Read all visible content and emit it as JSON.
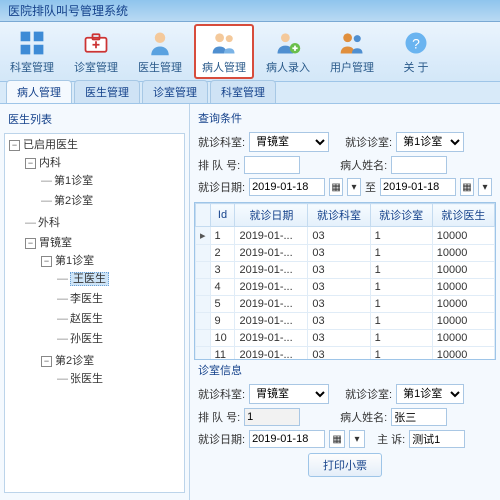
{
  "title": "医院排队叫号管理系统",
  "toolbar": [
    {
      "label": "科室管理"
    },
    {
      "label": "诊室管理"
    },
    {
      "label": "医生管理"
    },
    {
      "label": "病人管理",
      "selected": true
    },
    {
      "label": "病人录入"
    },
    {
      "label": "用户管理"
    },
    {
      "label": "关 于"
    }
  ],
  "tabs": [
    {
      "label": "病人管理",
      "active": true
    },
    {
      "label": "医生管理"
    },
    {
      "label": "诊室管理"
    },
    {
      "label": "科室管理"
    }
  ],
  "sidebar": {
    "title": "医生列表"
  },
  "tree": {
    "root": "已启用医生",
    "n_internal": "内科",
    "n_int_r1": "第1诊室",
    "n_int_r2": "第2诊室",
    "n_surgery": "外科",
    "n_gastro": "胃镜室",
    "n_g_r1": "第1诊室",
    "d_wang": "王医生",
    "d_li": "李医生",
    "d_zhao": "赵医生",
    "d_sun": "孙医生",
    "n_g_r2": "第2诊室",
    "d_zhang": "张医生"
  },
  "query": {
    "title": "查询条件",
    "dept_label": "就诊科室:",
    "dept_value": "胃镜室",
    "room_label": "就诊诊室:",
    "room_value": "第1诊室",
    "queue_label": "排 队 号:",
    "queue_value": "",
    "name_label": "病人姓名:",
    "name_value": "",
    "date_label": "就诊日期:",
    "date_from": "2019-01-18",
    "to_label": "至",
    "date_to": "2019-01-18"
  },
  "grid": {
    "headers": [
      "Id",
      "就诊日期",
      "就诊科室",
      "就诊诊室",
      "就诊医生"
    ],
    "rows": [
      {
        "mark": "▸",
        "cells": [
          "1",
          "2019-01-...",
          "03",
          "1",
          "10000"
        ]
      },
      {
        "mark": "",
        "cells": [
          "2",
          "2019-01-...",
          "03",
          "1",
          "10000"
        ]
      },
      {
        "mark": "",
        "cells": [
          "3",
          "2019-01-...",
          "03",
          "1",
          "10000"
        ]
      },
      {
        "mark": "",
        "cells": [
          "4",
          "2019-01-...",
          "03",
          "1",
          "10000"
        ]
      },
      {
        "mark": "",
        "cells": [
          "5",
          "2019-01-...",
          "03",
          "1",
          "10000"
        ]
      },
      {
        "mark": "",
        "cells": [
          "9",
          "2019-01-...",
          "03",
          "1",
          "10000"
        ]
      },
      {
        "mark": "",
        "cells": [
          "10",
          "2019-01-...",
          "03",
          "1",
          "10000"
        ]
      },
      {
        "mark": "",
        "cells": [
          "11",
          "2019-01-...",
          "03",
          "1",
          "10000"
        ]
      }
    ]
  },
  "info": {
    "title": "诊室信息",
    "dept_label": "就诊科室:",
    "dept_value": "胃镜室",
    "room_label": "就诊诊室:",
    "room_value": "第1诊室",
    "queue_label": "排 队 号:",
    "queue_value": "1",
    "name_label": "病人姓名:",
    "name_value": "张三",
    "date_label": "就诊日期:",
    "date_value": "2019-01-18",
    "note_label": "主    诉:",
    "note_value": "测试1"
  },
  "print_btn": "打印小票"
}
